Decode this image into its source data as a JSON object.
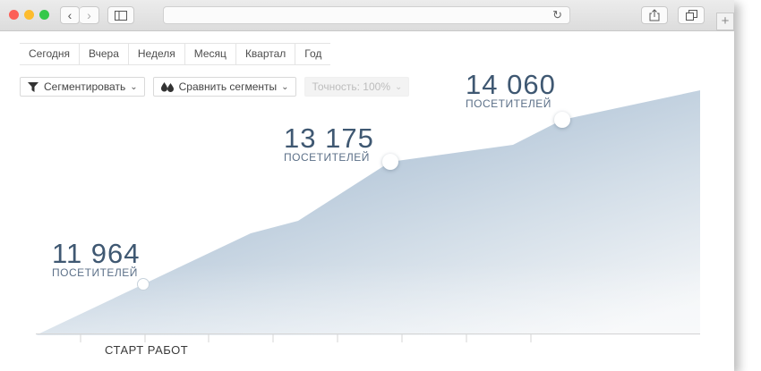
{
  "browser": {
    "reload_icon": "reload-icon",
    "share_icon": "share-icon",
    "tabs_icon": "tabs-overview-icon",
    "new_tab_label": "+"
  },
  "period_tabs": [
    "Сегодня",
    "Вчера",
    "Неделя",
    "Месяц",
    "Квартал",
    "Год"
  ],
  "controls": {
    "segment_label": "Сегментировать",
    "compare_label": "Сравнить сегменты",
    "accuracy_label": "Точность: 100%"
  },
  "chart_data": {
    "type": "area",
    "points": [
      11964,
      13175,
      14060
    ],
    "annotations": [
      {
        "value": "11 964",
        "unit": "ПОСЕТИТЕЛЕЙ"
      },
      {
        "value": "13 175",
        "unit": "ПОСЕТИТЕЛЕЙ"
      },
      {
        "value": "14 060",
        "unit": "ПОСЕТИТЕЛЕЙ"
      }
    ],
    "start_label": "СТАРТ РАБОТ",
    "colors": {
      "fill_dark": "#a8bdd2",
      "fill_light": "#eef2f6",
      "text": "#3f5872"
    }
  }
}
